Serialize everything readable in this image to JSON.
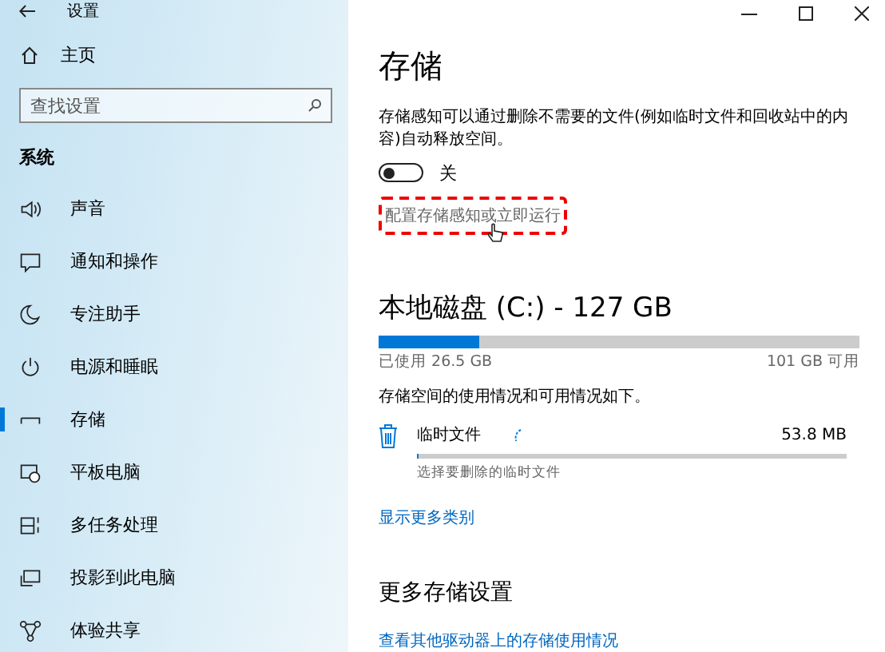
{
  "window": {
    "title": "设置"
  },
  "sidebar": {
    "home": "主页",
    "search": {
      "placeholder": "查找设置"
    },
    "section": "系统",
    "items": [
      {
        "label": "声音",
        "selected": false
      },
      {
        "label": "通知和操作",
        "selected": false
      },
      {
        "label": "专注助手",
        "selected": false
      },
      {
        "label": "电源和睡眠",
        "selected": false
      },
      {
        "label": "存储",
        "selected": true
      },
      {
        "label": "平板电脑",
        "selected": false
      },
      {
        "label": "多任务处理",
        "selected": false
      },
      {
        "label": "投影到此电脑",
        "selected": false
      },
      {
        "label": "体验共享",
        "selected": false
      }
    ]
  },
  "content": {
    "title": "存储",
    "description": "存储感知可以通过删除不需要的文件(例如临时文件和回收站中的内容)自动释放空间。",
    "toggle": {
      "on": false,
      "label": "关"
    },
    "configure_link": "配置存储感知或立即运行",
    "disk": {
      "title": "本地磁盘 (C:) - 127 GB",
      "level": 0.21,
      "used": "已使用 26.5 GB",
      "free": "101 GB 可用"
    },
    "usage_text": "存储空间的使用情况和可用情况如下。",
    "categories": [
      {
        "name": "临时文件",
        "size": "53.8 MB",
        "level": 0.005,
        "hint": "选择要删除的临时文件"
      }
    ],
    "more_link": "显示更多类别",
    "more_title": "更多存储设置",
    "other_link": "查看其他驱动器上的存储使用情况"
  }
}
